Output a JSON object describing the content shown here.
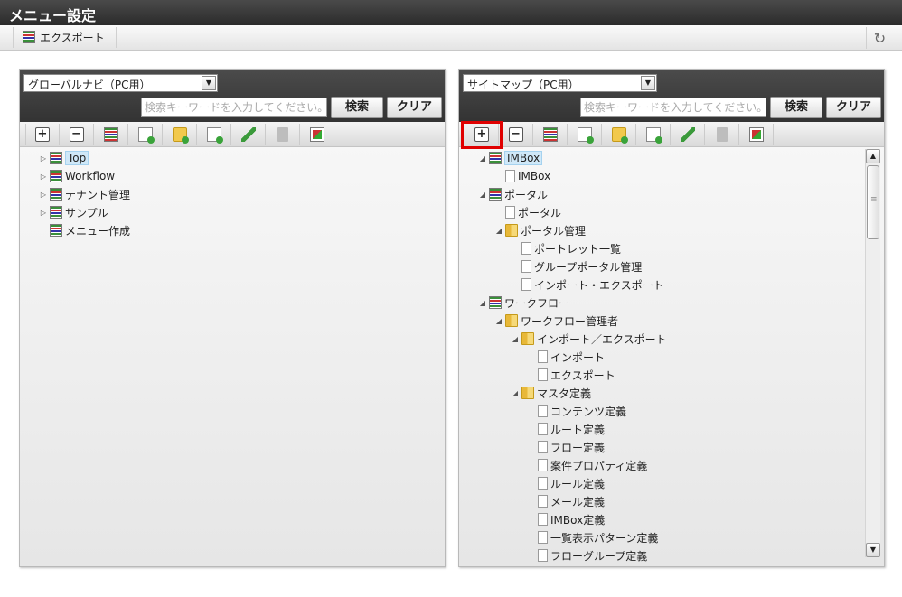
{
  "app": {
    "title": "メニュー設定"
  },
  "toolbar": {
    "export_label": "エクスポート",
    "export_icon": "export-icon",
    "refresh_icon": "refresh-icon"
  },
  "left_panel": {
    "select_value": "グローバルナビ（PC用）",
    "search_placeholder": "検索キーワードを入力してください。",
    "search_label": "検索",
    "clear_label": "クリア",
    "tree": [
      {
        "label": "Top",
        "type": "menu",
        "level": 0,
        "twisty": "collapsed",
        "selected": true
      },
      {
        "label": "Workflow",
        "type": "menu",
        "level": 0,
        "twisty": "collapsed"
      },
      {
        "label": "テナント管理",
        "type": "menu",
        "level": 0,
        "twisty": "collapsed"
      },
      {
        "label": "サンプル",
        "type": "menu",
        "level": 0,
        "twisty": "collapsed"
      },
      {
        "label": "メニュー作成",
        "type": "menu",
        "level": 0,
        "twisty": "none"
      }
    ]
  },
  "right_panel": {
    "select_value": "サイトマップ（PC用）",
    "search_placeholder": "検索キーワードを入力してください。",
    "search_label": "検索",
    "clear_label": "クリア",
    "tree": [
      {
        "label": "IMBox",
        "type": "menu",
        "level": 0,
        "twisty": "expanded",
        "selected": true
      },
      {
        "label": "IMBox",
        "type": "page",
        "level": 1,
        "twisty": "none"
      },
      {
        "label": "ポータル",
        "type": "menu",
        "level": 0,
        "twisty": "expanded"
      },
      {
        "label": "ポータル",
        "type": "page",
        "level": 1,
        "twisty": "none"
      },
      {
        "label": "ポータル管理",
        "type": "folder",
        "level": 1,
        "twisty": "expanded"
      },
      {
        "label": "ポートレット一覧",
        "type": "page",
        "level": 2,
        "twisty": "none"
      },
      {
        "label": "グループポータル管理",
        "type": "page",
        "level": 2,
        "twisty": "none"
      },
      {
        "label": "インポート・エクスポート",
        "type": "page",
        "level": 2,
        "twisty": "none"
      },
      {
        "label": "ワークフロー",
        "type": "menu",
        "level": 0,
        "twisty": "expanded"
      },
      {
        "label": "ワークフロー管理者",
        "type": "folder",
        "level": 1,
        "twisty": "expanded"
      },
      {
        "label": "インポート／エクスポート",
        "type": "folder",
        "level": 2,
        "twisty": "expanded"
      },
      {
        "label": "インポート",
        "type": "page",
        "level": 3,
        "twisty": "none"
      },
      {
        "label": "エクスポート",
        "type": "page",
        "level": 3,
        "twisty": "none"
      },
      {
        "label": "マスタ定義",
        "type": "folder",
        "level": 2,
        "twisty": "expanded"
      },
      {
        "label": "コンテンツ定義",
        "type": "page",
        "level": 3,
        "twisty": "none"
      },
      {
        "label": "ルート定義",
        "type": "page",
        "level": 3,
        "twisty": "none"
      },
      {
        "label": "フロー定義",
        "type": "page",
        "level": 3,
        "twisty": "none"
      },
      {
        "label": "案件プロパティ定義",
        "type": "page",
        "level": 3,
        "twisty": "none"
      },
      {
        "label": "ルール定義",
        "type": "page",
        "level": 3,
        "twisty": "none"
      },
      {
        "label": "メール定義",
        "type": "page",
        "level": 3,
        "twisty": "none"
      },
      {
        "label": "IMBox定義",
        "type": "page",
        "level": 3,
        "twisty": "none"
      },
      {
        "label": "一覧表示パターン定義",
        "type": "page",
        "level": 3,
        "twisty": "none"
      },
      {
        "label": "フローグループ定義",
        "type": "page",
        "level": 3,
        "twisty": "none"
      }
    ]
  },
  "tree_toolbar_icons": [
    "add-icon",
    "remove-icon",
    "add-menu-icon",
    "add-page-icon",
    "add-folder-icon",
    "new-page-icon",
    "edit-icon",
    "delete-icon",
    "permission-icon"
  ],
  "colors": {
    "header_dark": "#333333",
    "highlight_red": "#e00000",
    "selection_blue": "#cfe8f8"
  }
}
